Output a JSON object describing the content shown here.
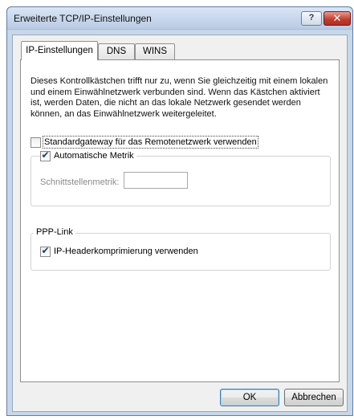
{
  "window": {
    "title": "Erweiterte TCP/IP-Einstellungen",
    "help_label": "?",
    "close_label": "✕"
  },
  "tabs": [
    {
      "label": "IP-Einstellungen",
      "active": true
    },
    {
      "label": "DNS",
      "active": false
    },
    {
      "label": "WINS",
      "active": false
    }
  ],
  "ip_settings": {
    "description": "Dieses Kontrollkästchen trifft nur zu, wenn Sie gleichzeitig mit einem lokalen und einem Einwählnetzwerk verbunden sind. Wenn das Kästchen aktiviert ist, werden Daten, die nicht an das lokale Netzwerk gesendet werden können, an das Einwählnetzwerk weitergeleitet.",
    "default_gateway": {
      "label": "Standardgateway für das Remotenetzwerk verwenden",
      "checked": false
    },
    "auto_metric": {
      "label": "Automatische Metrik",
      "checked": true
    },
    "interface_metric": {
      "label": "Schnittstellenmetrik:",
      "value": "",
      "enabled": false
    },
    "ppp_link": {
      "legend": "PPP-Link",
      "header_compression": {
        "label": "IP-Headerkomprimierung verwenden",
        "checked": true
      }
    }
  },
  "buttons": {
    "ok": "OK",
    "cancel": "Abbrechen"
  },
  "check_glyph": "✔"
}
